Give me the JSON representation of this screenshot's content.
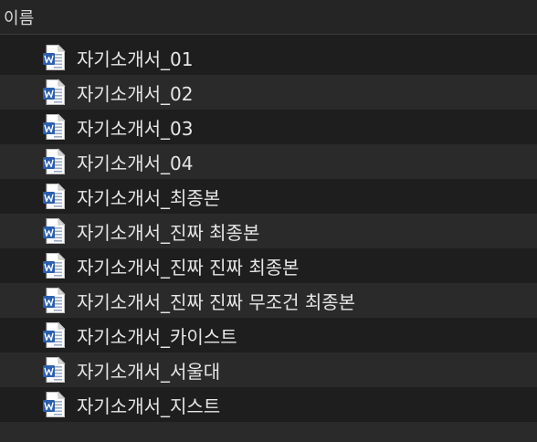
{
  "header": {
    "name_column_label": "이름"
  },
  "files": [
    {
      "name": "자기소개서_01",
      "icon": "word-document-icon"
    },
    {
      "name": "자기소개서_02",
      "icon": "word-document-icon"
    },
    {
      "name": "자기소개서_03",
      "icon": "word-document-icon"
    },
    {
      "name": "자기소개서_04",
      "icon": "word-document-icon"
    },
    {
      "name": "자기소개서_최종본",
      "icon": "word-document-icon"
    },
    {
      "name": "자기소개서_진짜 최종본",
      "icon": "word-document-icon"
    },
    {
      "name": "자기소개서_진짜 진짜 최종본",
      "icon": "word-document-icon"
    },
    {
      "name": "자기소개서_진짜 진짜 무조건 최종본",
      "icon": "word-document-icon"
    },
    {
      "name": "자기소개서_카이스트",
      "icon": "word-document-icon"
    },
    {
      "name": "자기소개서_서울대",
      "icon": "word-document-icon"
    },
    {
      "name": "자기소개서_지스트",
      "icon": "word-document-icon"
    }
  ],
  "colors": {
    "background": "#1e1e1e",
    "row_alt": "#2a2a2a",
    "word_blue": "#2b5fae"
  }
}
